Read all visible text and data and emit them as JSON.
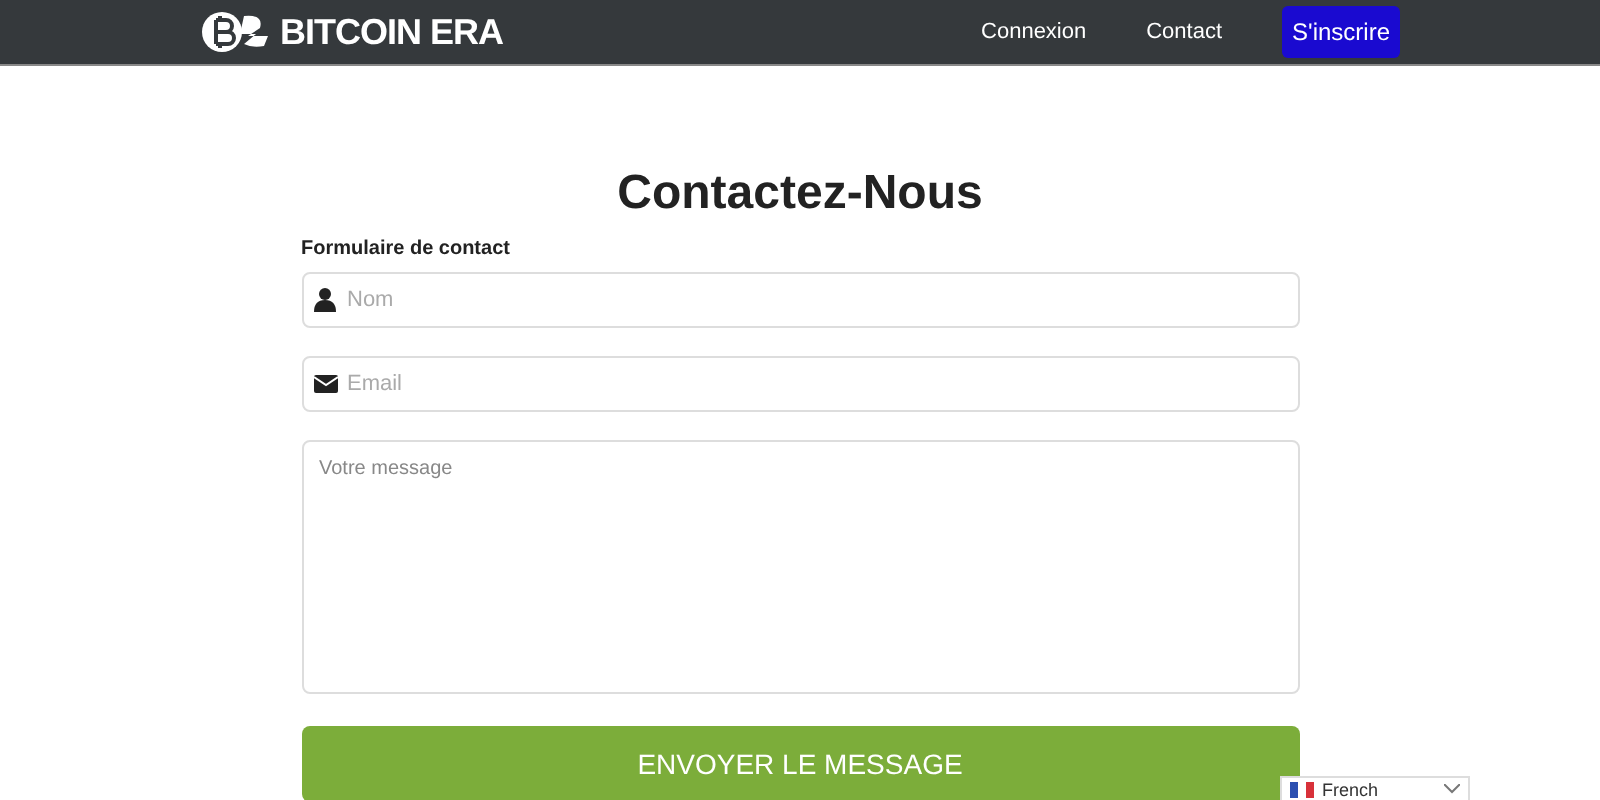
{
  "header": {
    "logo": "BITCOIN ERA",
    "nav": [
      {
        "label": "Connexion",
        "kind": "link"
      },
      {
        "label": "Contact",
        "kind": "link"
      },
      {
        "label": "S'inscrire",
        "kind": "cta"
      }
    ]
  },
  "title": "Contactez-Nous",
  "form": {
    "label": "Formulaire de contact",
    "fields": [
      {
        "kind": "name",
        "placeholder": "Nom"
      },
      {
        "kind": "email",
        "placeholder": "Email"
      },
      {
        "kind": "message",
        "placeholder": "Votre message"
      }
    ],
    "submit": "ENVOYER LE MESSAGE"
  },
  "language": {
    "label": "French"
  }
}
